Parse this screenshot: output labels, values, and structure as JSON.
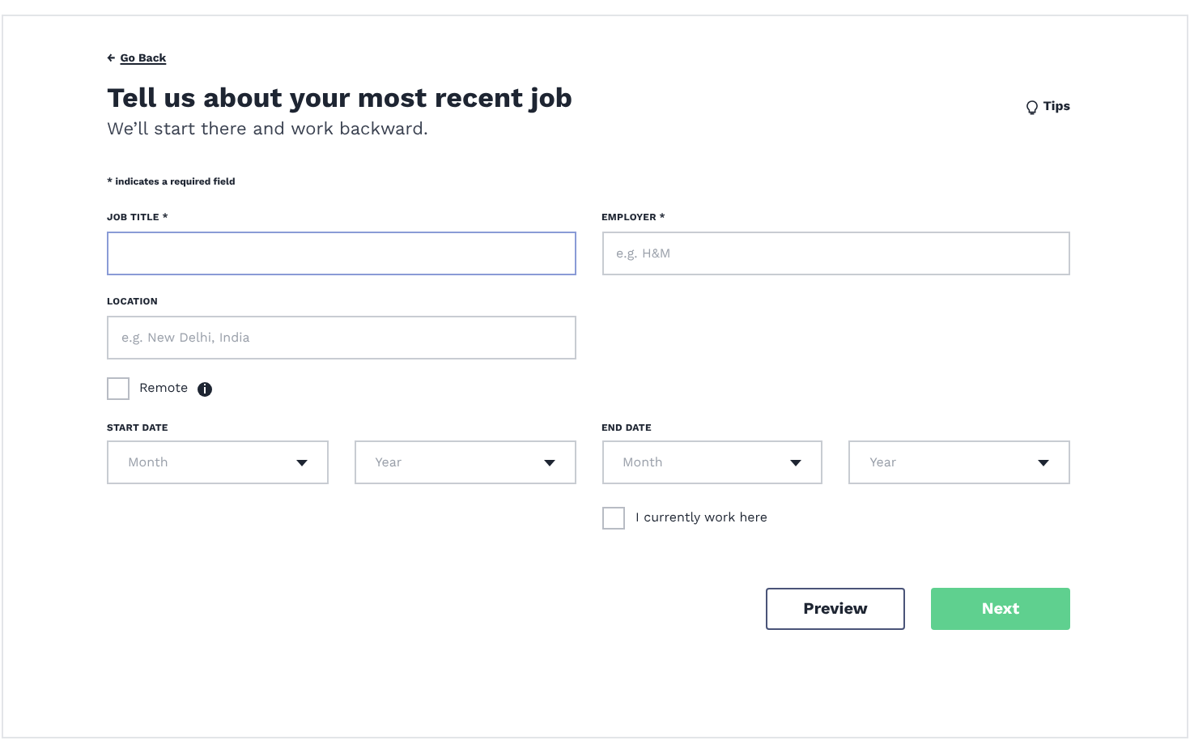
{
  "back_link": {
    "arrow": "←",
    "label": "Go Back"
  },
  "title": "Tell us about your most recent job",
  "subtitle": "We’ll start there and work backward.",
  "tips": {
    "label": "Tips"
  },
  "required_note": "* indicates a required field",
  "job_title": {
    "label": "JOB TITLE *",
    "focused": true
  },
  "employer": {
    "label": "EMPLOYER *",
    "placeholder": "e.g. H&M",
    "focused": false
  },
  "location": {
    "label": "LOCATION",
    "placeholder": "e.g. New Delhi, India",
    "focused": false
  },
  "remote": {
    "label": "Remote",
    "checked": false
  },
  "start_date": {
    "label": "START DATE",
    "selects": [
      {
        "placeholder": "Month"
      },
      {
        "placeholder": "Year"
      }
    ]
  },
  "end_date": {
    "label": "END DATE",
    "selects": [
      {
        "placeholder": "Month"
      },
      {
        "placeholder": "Year"
      }
    ]
  },
  "current": {
    "label": "I currently work here",
    "checked": false
  },
  "buttons": [
    {
      "kind": "secondary",
      "label": "Preview"
    },
    {
      "kind": "primary",
      "label": "Next"
    }
  ]
}
